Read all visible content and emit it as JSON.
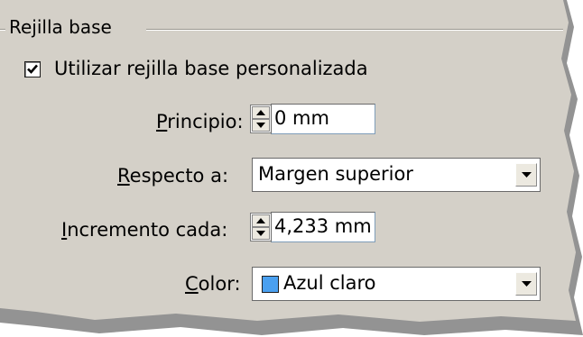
{
  "group": {
    "title": "Rejilla base"
  },
  "custom_grid": {
    "label": "Utilizar rejilla base personalizada",
    "checked": true
  },
  "start": {
    "label_accel": "P",
    "label_rest": "rincipio:",
    "value": "0 mm"
  },
  "relative_to": {
    "label_accel": "R",
    "label_rest": "especto a:",
    "value": "Margen superior"
  },
  "increment": {
    "label_accel": "I",
    "label_rest": "ncremento cada:",
    "value": "4,233 mm"
  },
  "color": {
    "label_accel": "C",
    "label_rest": "olor:",
    "value": "Azul claro",
    "swatch": "#4aa0f0"
  },
  "theme": {
    "panel": "#d4d0c8",
    "shadow": "#3a3a3a",
    "check_mark": "#000000"
  }
}
